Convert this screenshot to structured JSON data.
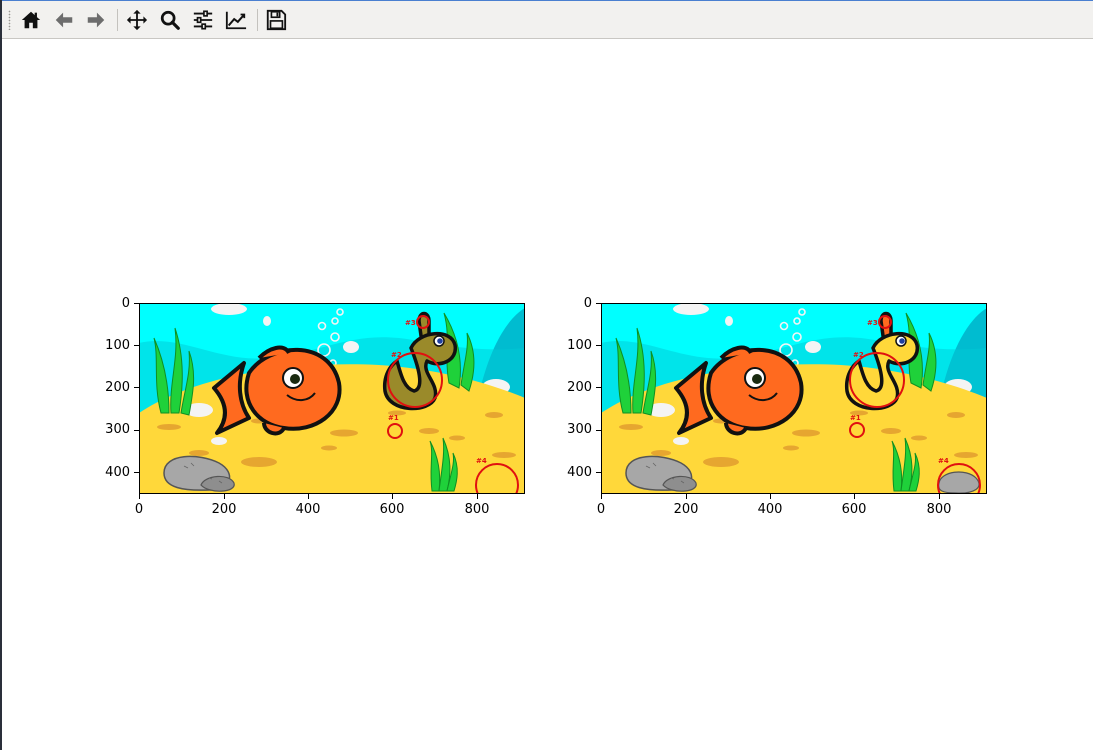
{
  "toolbar": {
    "buttons": [
      {
        "id": "home",
        "icon": "home-icon"
      },
      {
        "id": "back",
        "icon": "arrow-left-icon"
      },
      {
        "id": "forward",
        "icon": "arrow-right-icon"
      },
      {
        "id": "pan",
        "icon": "move-icon"
      },
      {
        "id": "zoom",
        "icon": "magnifier-icon"
      },
      {
        "id": "subplots",
        "icon": "sliders-icon"
      },
      {
        "id": "edit",
        "icon": "line-chart-icon"
      },
      {
        "id": "save",
        "icon": "floppy-disk-icon"
      }
    ]
  },
  "figure": {
    "colors": {
      "water": "#00ffff",
      "sand": "#ffd83a",
      "fish": "#ff6a1f",
      "seaweed": "#1fd13a",
      "rock": "#a7a7a7",
      "marker": "#e01010",
      "worm_left": "#9a8a2a",
      "worm_right": "#ffd83a"
    },
    "panels": [
      {
        "id": "left",
        "x_ticks": [
          "0",
          "200",
          "400",
          "600",
          "800"
        ],
        "y_ticks": [
          "0",
          "100",
          "200",
          "300",
          "400"
        ],
        "markers": [
          "#1",
          "#2",
          "#3",
          "#4"
        ]
      },
      {
        "id": "right",
        "x_ticks": [
          "0",
          "200",
          "400",
          "600",
          "800"
        ],
        "y_ticks": [
          "0",
          "100",
          "200",
          "300",
          "400"
        ],
        "markers": [
          "#1",
          "#2",
          "#3",
          "#4"
        ]
      }
    ]
  }
}
